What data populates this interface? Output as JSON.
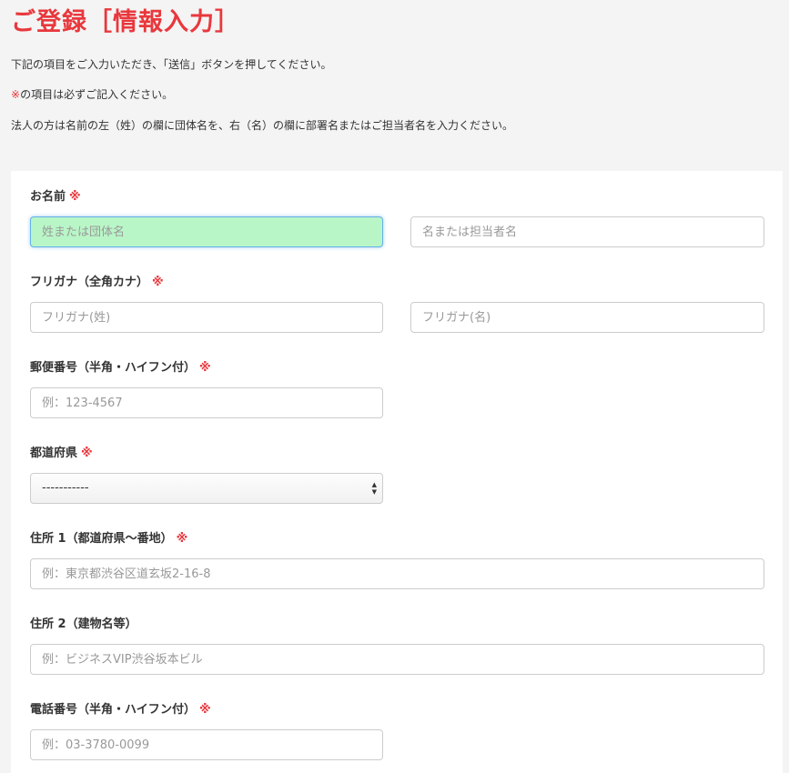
{
  "page": {
    "title": "ご登録［情報入力］",
    "intro_line1": "下記の項目をご入力いただき、「送信」ボタンを押してください。",
    "intro_line2_mark": "※",
    "intro_line2_rest": "の項目は必ずご記入ください。",
    "intro_line3": "法人の方は名前の左（姓）の欄に団体名を、右（名）の欄に部署名またはご担当者名を入力ください。"
  },
  "form": {
    "required_mark": "※",
    "name": {
      "label": "お名前",
      "last_placeholder": "姓または団体名",
      "first_placeholder": "名または担当者名"
    },
    "furigana": {
      "label": "フリガナ（全角カナ）",
      "last_placeholder": "フリガナ(姓)",
      "first_placeholder": "フリガナ(名)"
    },
    "postal": {
      "label": "郵便番号（半角・ハイフン付）",
      "placeholder": "例：123-4567"
    },
    "prefecture": {
      "label": "都道府県",
      "selected": "-----------"
    },
    "address1": {
      "label": "住所 1（都道府県〜番地）",
      "placeholder": "例：東京都渋谷区道玄坂2-16-8"
    },
    "address2": {
      "label": "住所 2（建物名等）",
      "placeholder": "例：ビジネスVIP渋谷坂本ビル"
    },
    "phone": {
      "label": "電話番号（半角・ハイフン付）",
      "placeholder": "例：03-3780-0099"
    }
  },
  "colors": {
    "accent_red": "#e8383d",
    "focused_input_bg": "#b9f6c7",
    "page_bg": "#f4f4f4"
  }
}
